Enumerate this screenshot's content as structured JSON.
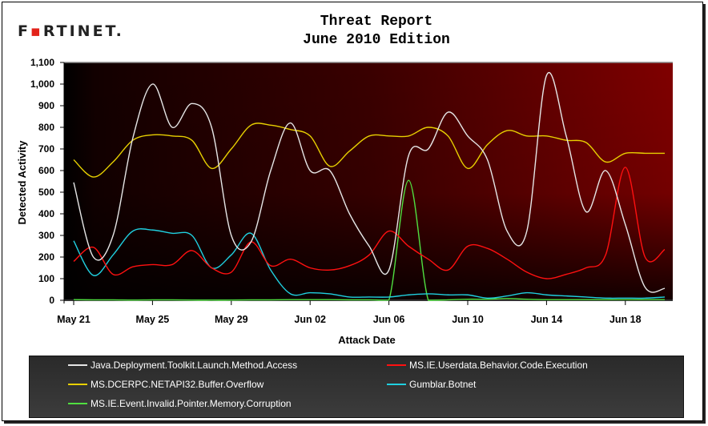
{
  "brand": {
    "logo_text_pre": "F",
    "logo_text_o": "▪",
    "logo_text_post": "RTINET."
  },
  "chart_data": {
    "type": "line",
    "title": "Threat Report",
    "subtitle": "June 2010 Edition",
    "xlabel": "Attack Date",
    "ylabel": "Detected Activity",
    "ylim": [
      0,
      1100
    ],
    "yticks": [
      "0",
      "100",
      "200",
      "300",
      "400",
      "500",
      "600",
      "700",
      "800",
      "900",
      "1,000",
      "1,100"
    ],
    "ytick_values": [
      0,
      100,
      200,
      300,
      400,
      500,
      600,
      700,
      800,
      900,
      1000,
      1100
    ],
    "x": [
      "May 21",
      "May 22",
      "May 23",
      "May 24",
      "May 25",
      "May 26",
      "May 27",
      "May 28",
      "May 29",
      "May 30",
      "May 31",
      "Jun 01",
      "Jun 02",
      "Jun 03",
      "Jun 04",
      "Jun 05",
      "Jun 06",
      "Jun 07",
      "Jun 08",
      "Jun 09",
      "Jun 10",
      "Jun 11",
      "Jun 12",
      "Jun 13",
      "Jun 14",
      "Jun 15",
      "Jun 16",
      "Jun 17",
      "Jun 18",
      "Jun 19",
      "Jun 20"
    ],
    "xticks": [
      "May 21",
      "May 25",
      "May 29",
      "Jun 02",
      "Jun 06",
      "Jun 10",
      "Jun 14",
      "Jun 18"
    ],
    "xtick_indices": [
      0,
      4,
      8,
      12,
      16,
      20,
      24,
      28
    ],
    "grid": false,
    "legend_position": "bottom",
    "series": [
      {
        "name": "Java.Deployment.Toolkit.Launch.Method.Access",
        "color": "#e6e6e6",
        "values": [
          545,
          200,
          300,
          750,
          1000,
          800,
          910,
          800,
          300,
          270,
          600,
          820,
          600,
          600,
          400,
          250,
          140,
          670,
          700,
          870,
          760,
          650,
          320,
          320,
          1040,
          760,
          410,
          600,
          350,
          60,
          55
        ]
      },
      {
        "name": "MS.IE.Userdata.Behavior.Code.Execution",
        "color": "#ff1010",
        "values": [
          180,
          245,
          120,
          155,
          165,
          165,
          230,
          150,
          130,
          270,
          160,
          190,
          150,
          140,
          160,
          210,
          320,
          250,
          190,
          140,
          250,
          240,
          190,
          130,
          100,
          120,
          150,
          210,
          615,
          200,
          235
        ]
      },
      {
        "name": "MS.DCERPC.NETAPI32.Buffer.Overflow",
        "color": "#e8d000",
        "values": [
          650,
          570,
          640,
          740,
          765,
          760,
          740,
          610,
          700,
          810,
          810,
          790,
          760,
          620,
          690,
          760,
          760,
          760,
          800,
          760,
          610,
          720,
          785,
          760,
          760,
          740,
          730,
          640,
          680,
          680,
          680
        ]
      },
      {
        "name": "Gumblar.Botnet",
        "color": "#20d0e0",
        "values": [
          275,
          115,
          210,
          320,
          325,
          310,
          300,
          150,
          210,
          310,
          140,
          30,
          35,
          30,
          15,
          15,
          15,
          25,
          30,
          25,
          25,
          10,
          20,
          35,
          25,
          20,
          15,
          10,
          10,
          10,
          15
        ]
      },
      {
        "name": "MS.IE.Event.Invalid.Pointer.Memory.Corruption",
        "color": "#50e040",
        "values": [
          3,
          2,
          2,
          1,
          2,
          2,
          1,
          1,
          1,
          2,
          2,
          3,
          3,
          3,
          2,
          2,
          1,
          555,
          0,
          2,
          5,
          5,
          8,
          5,
          3,
          3,
          3,
          3,
          3,
          3,
          3
        ]
      }
    ]
  }
}
